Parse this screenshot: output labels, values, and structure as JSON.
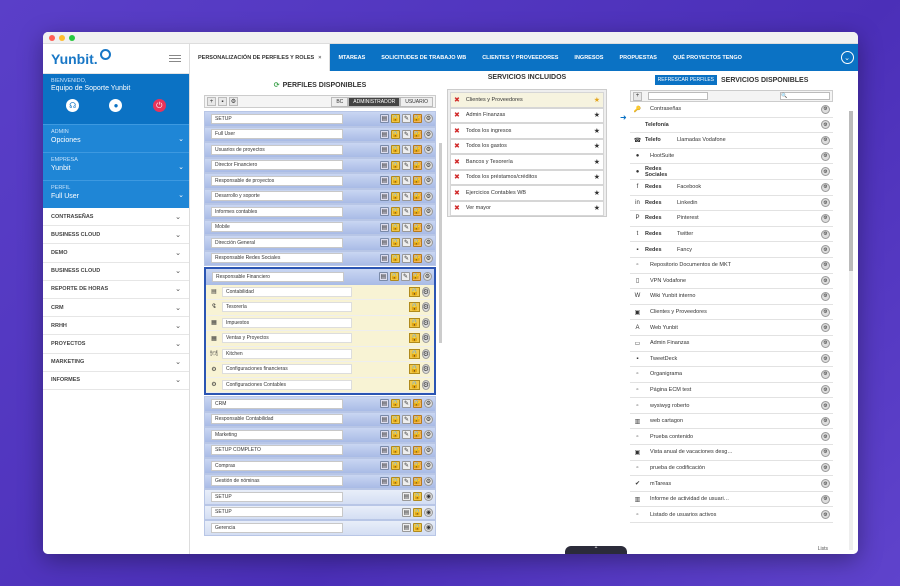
{
  "sidebar": {
    "logo": "Yunbit.",
    "welcome_label": "BIENVENIDO,",
    "welcome_name": "Equipo de Soporte Yunbit",
    "sections": [
      {
        "label": "ADMIN",
        "value": "Opciones"
      },
      {
        "label": "EMPRESA",
        "value": "Yunbit"
      },
      {
        "label": "PERFIL",
        "value": "Full User"
      }
    ],
    "menu": [
      "CONTRASEÑAS",
      "BUSINESS CLOUD",
      "DEMO",
      "BUSINESS CLOUD",
      "REPORTE DE HORAS",
      "CRM",
      "RRHH",
      "PROYECTOS",
      "MARKETING",
      "INFORMES"
    ]
  },
  "tabs": [
    {
      "label": "PERSONALIZACIÓN DE PERFILES Y ROLES",
      "close": "×"
    },
    {
      "label": "MTAREAS"
    },
    {
      "label": "SOLICITUDES DE TRABAJO WB"
    },
    {
      "label": "CLIENTES Y PROVEEDORES"
    },
    {
      "label": "INGRESOS"
    },
    {
      "label": "PROPUESTAS"
    },
    {
      "label": "QUÉ PROYECTOS TENGO"
    }
  ],
  "perfiles": {
    "title": "PERFILES DISPONIBLES",
    "role_tabs": [
      "BC",
      "ADMINISTRADOR",
      "USUARIO"
    ],
    "items_top": [
      "SETUP",
      "Full User",
      "Usuarios de proyectos",
      "Director Financiero",
      "Responsable de proyectos",
      "Desarrollo y soporte",
      "Informes contables",
      "Mobile",
      "Dirección General",
      "Responsable Redes Sociales"
    ],
    "expanded": {
      "name": "Responsable Financiero",
      "children": [
        "Contabilidad",
        "Tesorería",
        "Impuestos",
        "Ventas y Proyectos",
        "Kitchen",
        "Configuraciones financieras",
        "Configuraciones Contables"
      ]
    },
    "items_bottom": [
      "CRM",
      "Responsable Contabilidad",
      "Marketing",
      "SETUP COMPLETO",
      "Compras",
      "Gestión de nóminas"
    ],
    "items_light": [
      "SETUP",
      "SETUP",
      "Gerencia"
    ]
  },
  "incluidos": {
    "title": "SERVICIOS INCLUIDOS",
    "items": [
      "Clientes y Proveedores",
      "Admin Finanzas",
      "Todos los ingresos",
      "Todos los gastos",
      "Bancos y Tesorería",
      "Todos los préstamos/créditos",
      "Ejercicios Contables WB",
      "Ver mayor"
    ]
  },
  "disponibles": {
    "refresh_label": "REFRESCAR PERFILES",
    "title": "SERVICIOS DISPONIBLES",
    "search_icon": "🔍",
    "items": [
      {
        "icon": "🔑",
        "cat": "",
        "name": "Contraseñas"
      },
      {
        "icon": "",
        "cat": "Telefonía",
        "name": "",
        "head": true
      },
      {
        "icon": "☎",
        "cat": "Telefo",
        "name": "Llamadas Vodafone"
      },
      {
        "icon": "●",
        "cat": "",
        "name": "HootSuite"
      },
      {
        "icon": "●",
        "cat": "Redes Sociales",
        "name": "",
        "head": true
      },
      {
        "icon": "f",
        "cat": "Redes",
        "name": "Facebook"
      },
      {
        "icon": "in",
        "cat": "Redes",
        "name": "Linkedin"
      },
      {
        "icon": "P",
        "cat": "Redes",
        "name": "Pinterest"
      },
      {
        "icon": "t",
        "cat": "Redes",
        "name": "Twitter"
      },
      {
        "icon": "▪",
        "cat": "Redes",
        "name": "Fancy"
      },
      {
        "icon": "▫",
        "cat": "",
        "name": "Repositorio Documentos de MKT"
      },
      {
        "icon": "▯",
        "cat": "",
        "name": "VPN Vodafone"
      },
      {
        "icon": "W",
        "cat": "",
        "name": "Wiki Yunbit interno"
      },
      {
        "icon": "▣",
        "cat": "",
        "name": "Clientes y Proveedores"
      },
      {
        "icon": "A",
        "cat": "",
        "name": "Web Yunbit"
      },
      {
        "icon": "▭",
        "cat": "",
        "name": "Admin Finanzas"
      },
      {
        "icon": "▪",
        "cat": "",
        "name": "TweetDeck"
      },
      {
        "icon": "▫",
        "cat": "",
        "name": "Organigrama"
      },
      {
        "icon": "▫",
        "cat": "",
        "name": "Página ECM test"
      },
      {
        "icon": "▫",
        "cat": "",
        "name": "wysiwyg roberto"
      },
      {
        "icon": "▥",
        "cat": "",
        "name": "web cartagon"
      },
      {
        "icon": "▫",
        "cat": "",
        "name": "Prueba contenido"
      },
      {
        "icon": "▣",
        "cat": "",
        "name": "Vista anual de vacaciones desg…"
      },
      {
        "icon": "▫",
        "cat": "",
        "name": "prueba de codificación"
      },
      {
        "icon": "✔",
        "cat": "",
        "name": "mTareas"
      },
      {
        "icon": "▥",
        "cat": "",
        "name": "Informe de actividad de usuari…"
      },
      {
        "icon": "▫",
        "cat": "",
        "name": "Listado de usuarios activos"
      }
    ]
  },
  "footer": {
    "lists_label": "Lists"
  }
}
